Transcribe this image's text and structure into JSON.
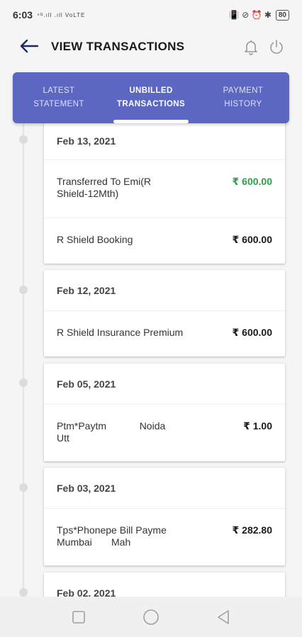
{
  "status_bar": {
    "time": "6:03",
    "left_icons": "⁴ᴳ.ıll .ıll VoLTE",
    "right_icons": "📳 ⊘ ⏰ ✱",
    "battery": "80"
  },
  "header": {
    "title": "VIEW TRANSACTIONS",
    "back_icon": "back-arrow-icon",
    "bell_icon": "bell-icon",
    "power_icon": "power-icon"
  },
  "tabs": [
    {
      "line1": "LATEST",
      "line2": "STATEMENT",
      "active": false
    },
    {
      "line1": "UNBILLED",
      "line2": "TRANSACTIONS",
      "active": true
    },
    {
      "line1": "PAYMENT",
      "line2": "HISTORY",
      "active": false
    }
  ],
  "colors": {
    "tab_bg": "#5b67c0",
    "credit_amount": "#2e9e4a",
    "page_bg": "#f5f5f5"
  },
  "groups": [
    {
      "date": "Feb 13, 2021",
      "transactions": [
        {
          "desc": "Transferred To Emi(R\nShield-12Mth)",
          "amount": "₹ 600.00",
          "credit": true
        },
        {
          "desc": "R Shield Booking",
          "amount": "₹ 600.00",
          "credit": false
        }
      ]
    },
    {
      "date": "Feb 12, 2021",
      "transactions": [
        {
          "desc": "R Shield Insurance Premium",
          "amount": "₹ 600.00",
          "credit": false
        }
      ]
    },
    {
      "date": "Feb 05, 2021",
      "transactions": [
        {
          "desc": "Ptm*Paytm            Noida\nUtt",
          "amount": "₹ 1.00",
          "credit": false
        }
      ]
    },
    {
      "date": "Feb 03, 2021",
      "transactions": [
        {
          "desc": "Tps*Phonepe Bill Payme\nMumbai       Mah",
          "amount": "₹ 282.80",
          "credit": false
        }
      ]
    },
    {
      "date": "Feb 02, 2021",
      "transactions": []
    }
  ],
  "nav_bar": {
    "recents_icon": "square-icon",
    "home_icon": "circle-icon",
    "back_icon": "triangle-back-icon"
  }
}
